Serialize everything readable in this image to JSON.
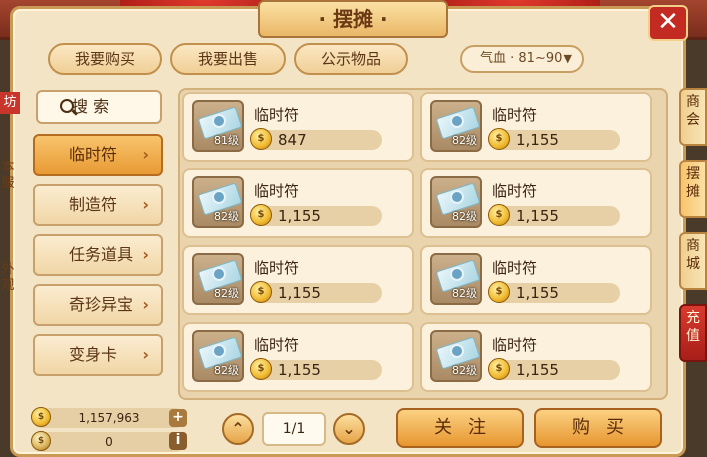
{
  "header": {
    "title": "· 摆摊 ·"
  },
  "top_tabs": [
    {
      "label": "我要购买"
    },
    {
      "label": "我要出售"
    },
    {
      "label": "公示物品"
    }
  ],
  "level_filter": {
    "label": "气血 · 81~90",
    "arrow": "▼"
  },
  "left_side": {
    "badge": "坊",
    "server": "本服",
    "other": "外观"
  },
  "search": {
    "label": "搜 索"
  },
  "categories": [
    {
      "label": "临时符",
      "active": true
    },
    {
      "label": "制造符"
    },
    {
      "label": "任务道具"
    },
    {
      "label": "奇珍异宝"
    },
    {
      "label": "变身卡"
    }
  ],
  "items": [
    {
      "name": "临时符",
      "level": "81级",
      "price": "847"
    },
    {
      "name": "临时符",
      "level": "82级",
      "price": "1,155"
    },
    {
      "name": "临时符",
      "level": "82级",
      "price": "1,155"
    },
    {
      "name": "临时符",
      "level": "82级",
      "price": "1,155"
    },
    {
      "name": "临时符",
      "level": "82级",
      "price": "1,155"
    },
    {
      "name": "临时符",
      "level": "82级",
      "price": "1,155"
    },
    {
      "name": "临时符",
      "level": "82级",
      "price": "1,155"
    },
    {
      "name": "临时符",
      "level": "82级",
      "price": "1,155"
    }
  ],
  "wallet": {
    "gold": "1,157,963",
    "points": "0"
  },
  "pagination": {
    "page": "1/1",
    "prev": "⌃",
    "next": "⌄"
  },
  "actions": {
    "follow": "关注",
    "buy": "购买"
  },
  "right_tabs": [
    {
      "label": "商会"
    },
    {
      "label": "摆摊"
    },
    {
      "label": "商城"
    },
    {
      "label": "充值"
    }
  ],
  "close_glyph": "✕",
  "coin_glyph": "$",
  "plus_glyph": "+",
  "info_glyph": "i",
  "chevron_glyph": "›"
}
